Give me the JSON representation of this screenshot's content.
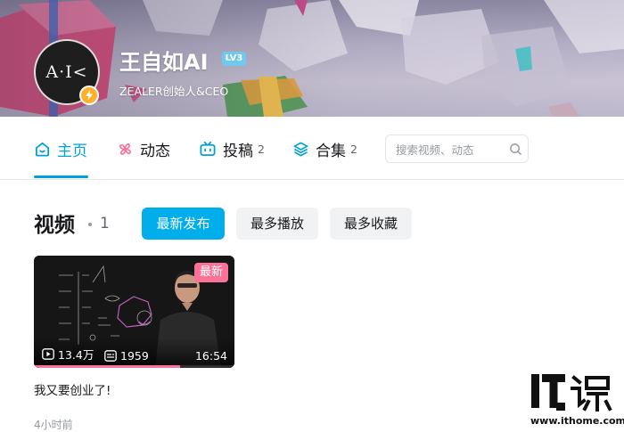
{
  "profile": {
    "name": "王自如AI",
    "level": "LV3",
    "title": "ZEALER创始人&CEO",
    "avatar_text": "A·I<"
  },
  "nav": {
    "tabs": [
      {
        "label": "主页",
        "icon": "home-icon",
        "count": ""
      },
      {
        "label": "动态",
        "icon": "pinwheel-icon",
        "count": ""
      },
      {
        "label": "投稿",
        "icon": "tv-icon",
        "count": "2"
      },
      {
        "label": "合集",
        "icon": "layers-icon",
        "count": "2"
      }
    ],
    "active_tab": "主页"
  },
  "search": {
    "placeholder": "搜索视频、动态",
    "icon": "search-icon"
  },
  "videos": {
    "title": "视频",
    "count": "1",
    "sort_options": [
      "最新发布",
      "最多播放",
      "最多收藏"
    ],
    "selected_sort": "最新发布",
    "items": [
      {
        "title": "我又要创业了!",
        "badge": "最新",
        "views": "13.4万",
        "danmaku": "1959",
        "duration": "16:54",
        "published": "4小时前",
        "watch_progress": 0.73
      }
    ]
  },
  "watermark": {
    "logo": "IT之家",
    "url": "www.ithome.com"
  },
  "colors": {
    "accent": "#00a1d6",
    "button_primary": "#00aeec",
    "badge_pink": "#fb7299",
    "level_badge": "#6fc9ec",
    "verify_badge": "#ffb027"
  }
}
